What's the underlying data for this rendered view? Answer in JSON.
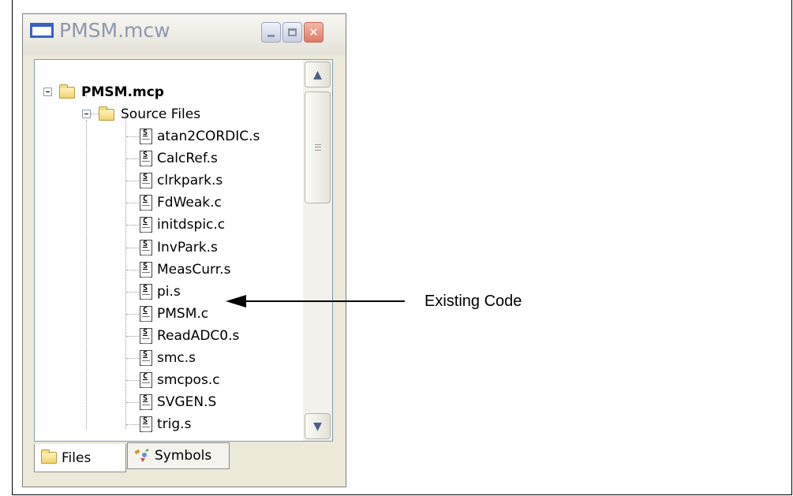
{
  "window": {
    "title": "PMSM.mcw",
    "controls": {
      "minimize": "minimize",
      "maximize": "maximize",
      "close": "close"
    }
  },
  "tree": {
    "project": "PMSM.mcp",
    "folder": "Source Files",
    "files": [
      {
        "name": "atan2CORDIC.s",
        "type": "S"
      },
      {
        "name": "CalcRef.s",
        "type": "S"
      },
      {
        "name": "clrkpark.s",
        "type": "S"
      },
      {
        "name": "FdWeak.c",
        "type": "C"
      },
      {
        "name": "initdspic.c",
        "type": "C"
      },
      {
        "name": "InvPark.s",
        "type": "S"
      },
      {
        "name": "MeasCurr.s",
        "type": "S"
      },
      {
        "name": "pi.s",
        "type": "S"
      },
      {
        "name": "PMSM.c",
        "type": "C"
      },
      {
        "name": "ReadADC0.s",
        "type": "S"
      },
      {
        "name": "smc.s",
        "type": "S"
      },
      {
        "name": "smcpos.c",
        "type": "C"
      },
      {
        "name": "SVGEN.S",
        "type": "S"
      },
      {
        "name": "trig.s",
        "type": "S"
      }
    ]
  },
  "tabs": {
    "files": "Files",
    "symbols": "Symbols"
  },
  "annotation": {
    "text": "Existing Code"
  },
  "icons": {
    "window": "window-icon",
    "folder": "folder-icon",
    "file": "source-file-icon",
    "symbols": "symbols-icon"
  }
}
